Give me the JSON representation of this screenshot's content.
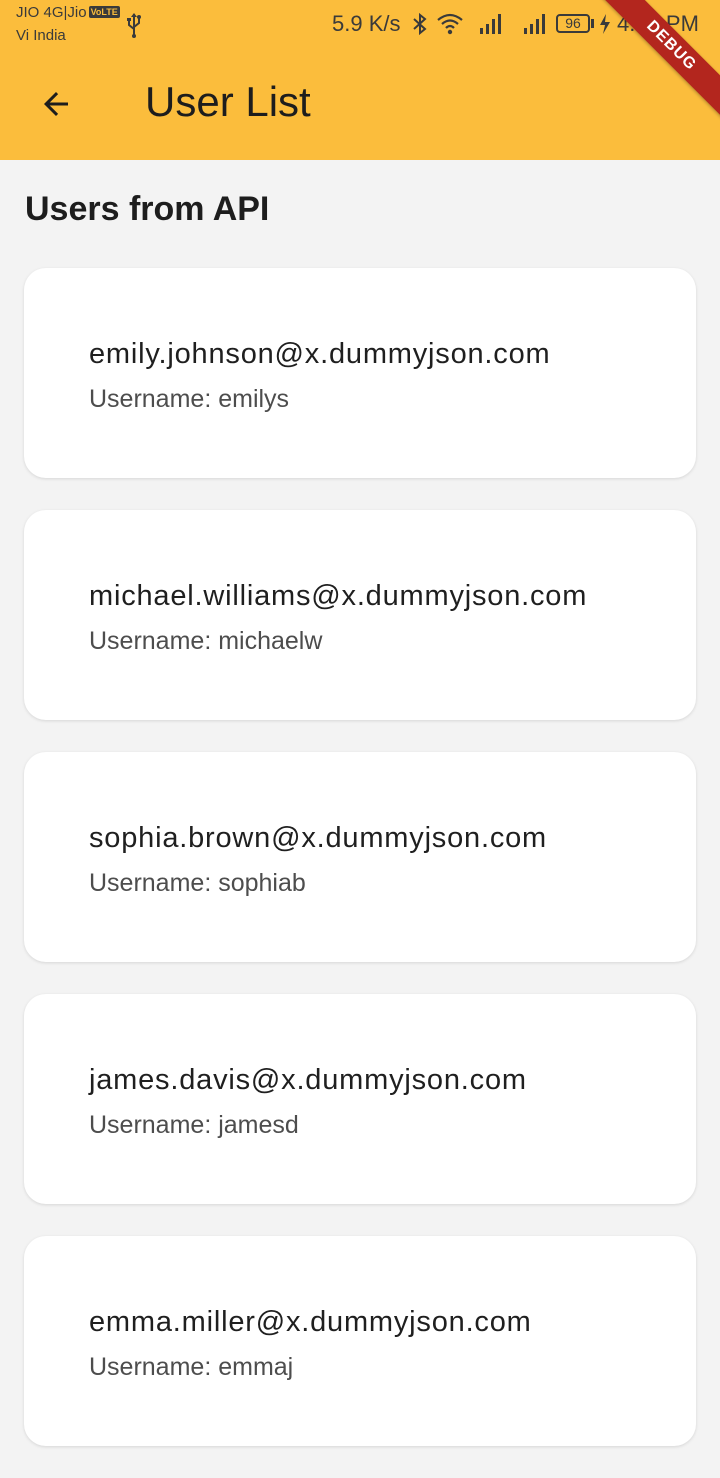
{
  "status_bar": {
    "carrier_line1": "JIO 4G|Jio",
    "volte_badge": "VoLTE",
    "carrier_line2": "Vi India",
    "net_speed": "5.9 K/s",
    "battery": "96",
    "time": "4:05 PM",
    "icons": [
      "usb-icon",
      "bluetooth-icon",
      "wifi-icon",
      "signal-icon",
      "signal-icon",
      "charging-bolt-icon"
    ]
  },
  "debug_banner": "DEBUG",
  "app_bar": {
    "title": "User List",
    "back_icon": "arrow-back-icon",
    "background_color": "#fbbd3c"
  },
  "section_title": "Users from API",
  "users": [
    {
      "email": "emily.johnson@x.dummyjson.com",
      "username": "Username: emilys"
    },
    {
      "email": "michael.williams@x.dummyjson.com",
      "username": "Username: michaelw"
    },
    {
      "email": "sophia.brown@x.dummyjson.com",
      "username": "Username: sophiab"
    },
    {
      "email": "james.davis@x.dummyjson.com",
      "username": "Username: jamesd"
    },
    {
      "email": "emma.miller@x.dummyjson.com",
      "username": "Username: emmaj"
    }
  ]
}
